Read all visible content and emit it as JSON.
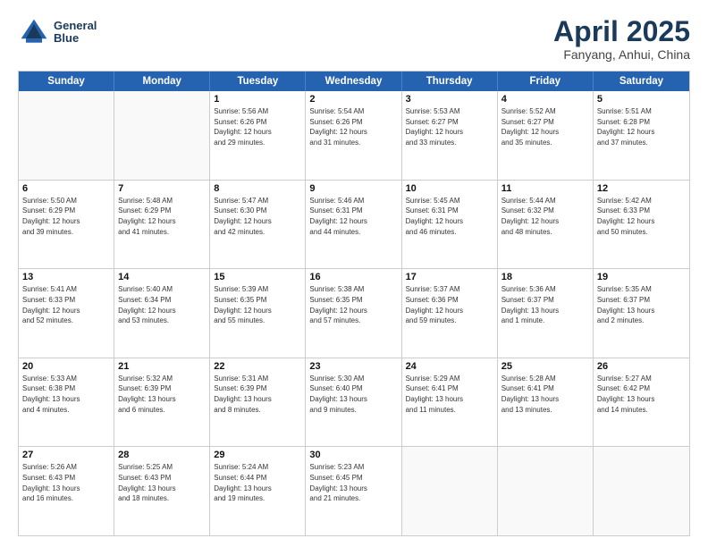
{
  "header": {
    "logo_line1": "General",
    "logo_line2": "Blue",
    "month": "April 2025",
    "location": "Fanyang, Anhui, China"
  },
  "days_of_week": [
    "Sunday",
    "Monday",
    "Tuesday",
    "Wednesday",
    "Thursday",
    "Friday",
    "Saturday"
  ],
  "weeks": [
    [
      {
        "num": "",
        "info": ""
      },
      {
        "num": "",
        "info": ""
      },
      {
        "num": "1",
        "info": "Sunrise: 5:56 AM\nSunset: 6:26 PM\nDaylight: 12 hours\nand 29 minutes."
      },
      {
        "num": "2",
        "info": "Sunrise: 5:54 AM\nSunset: 6:26 PM\nDaylight: 12 hours\nand 31 minutes."
      },
      {
        "num": "3",
        "info": "Sunrise: 5:53 AM\nSunset: 6:27 PM\nDaylight: 12 hours\nand 33 minutes."
      },
      {
        "num": "4",
        "info": "Sunrise: 5:52 AM\nSunset: 6:27 PM\nDaylight: 12 hours\nand 35 minutes."
      },
      {
        "num": "5",
        "info": "Sunrise: 5:51 AM\nSunset: 6:28 PM\nDaylight: 12 hours\nand 37 minutes."
      }
    ],
    [
      {
        "num": "6",
        "info": "Sunrise: 5:50 AM\nSunset: 6:29 PM\nDaylight: 12 hours\nand 39 minutes."
      },
      {
        "num": "7",
        "info": "Sunrise: 5:48 AM\nSunset: 6:29 PM\nDaylight: 12 hours\nand 41 minutes."
      },
      {
        "num": "8",
        "info": "Sunrise: 5:47 AM\nSunset: 6:30 PM\nDaylight: 12 hours\nand 42 minutes."
      },
      {
        "num": "9",
        "info": "Sunrise: 5:46 AM\nSunset: 6:31 PM\nDaylight: 12 hours\nand 44 minutes."
      },
      {
        "num": "10",
        "info": "Sunrise: 5:45 AM\nSunset: 6:31 PM\nDaylight: 12 hours\nand 46 minutes."
      },
      {
        "num": "11",
        "info": "Sunrise: 5:44 AM\nSunset: 6:32 PM\nDaylight: 12 hours\nand 48 minutes."
      },
      {
        "num": "12",
        "info": "Sunrise: 5:42 AM\nSunset: 6:33 PM\nDaylight: 12 hours\nand 50 minutes."
      }
    ],
    [
      {
        "num": "13",
        "info": "Sunrise: 5:41 AM\nSunset: 6:33 PM\nDaylight: 12 hours\nand 52 minutes."
      },
      {
        "num": "14",
        "info": "Sunrise: 5:40 AM\nSunset: 6:34 PM\nDaylight: 12 hours\nand 53 minutes."
      },
      {
        "num": "15",
        "info": "Sunrise: 5:39 AM\nSunset: 6:35 PM\nDaylight: 12 hours\nand 55 minutes."
      },
      {
        "num": "16",
        "info": "Sunrise: 5:38 AM\nSunset: 6:35 PM\nDaylight: 12 hours\nand 57 minutes."
      },
      {
        "num": "17",
        "info": "Sunrise: 5:37 AM\nSunset: 6:36 PM\nDaylight: 12 hours\nand 59 minutes."
      },
      {
        "num": "18",
        "info": "Sunrise: 5:36 AM\nSunset: 6:37 PM\nDaylight: 13 hours\nand 1 minute."
      },
      {
        "num": "19",
        "info": "Sunrise: 5:35 AM\nSunset: 6:37 PM\nDaylight: 13 hours\nand 2 minutes."
      }
    ],
    [
      {
        "num": "20",
        "info": "Sunrise: 5:33 AM\nSunset: 6:38 PM\nDaylight: 13 hours\nand 4 minutes."
      },
      {
        "num": "21",
        "info": "Sunrise: 5:32 AM\nSunset: 6:39 PM\nDaylight: 13 hours\nand 6 minutes."
      },
      {
        "num": "22",
        "info": "Sunrise: 5:31 AM\nSunset: 6:39 PM\nDaylight: 13 hours\nand 8 minutes."
      },
      {
        "num": "23",
        "info": "Sunrise: 5:30 AM\nSunset: 6:40 PM\nDaylight: 13 hours\nand 9 minutes."
      },
      {
        "num": "24",
        "info": "Sunrise: 5:29 AM\nSunset: 6:41 PM\nDaylight: 13 hours\nand 11 minutes."
      },
      {
        "num": "25",
        "info": "Sunrise: 5:28 AM\nSunset: 6:41 PM\nDaylight: 13 hours\nand 13 minutes."
      },
      {
        "num": "26",
        "info": "Sunrise: 5:27 AM\nSunset: 6:42 PM\nDaylight: 13 hours\nand 14 minutes."
      }
    ],
    [
      {
        "num": "27",
        "info": "Sunrise: 5:26 AM\nSunset: 6:43 PM\nDaylight: 13 hours\nand 16 minutes."
      },
      {
        "num": "28",
        "info": "Sunrise: 5:25 AM\nSunset: 6:43 PM\nDaylight: 13 hours\nand 18 minutes."
      },
      {
        "num": "29",
        "info": "Sunrise: 5:24 AM\nSunset: 6:44 PM\nDaylight: 13 hours\nand 19 minutes."
      },
      {
        "num": "30",
        "info": "Sunrise: 5:23 AM\nSunset: 6:45 PM\nDaylight: 13 hours\nand 21 minutes."
      },
      {
        "num": "",
        "info": ""
      },
      {
        "num": "",
        "info": ""
      },
      {
        "num": "",
        "info": ""
      }
    ]
  ]
}
